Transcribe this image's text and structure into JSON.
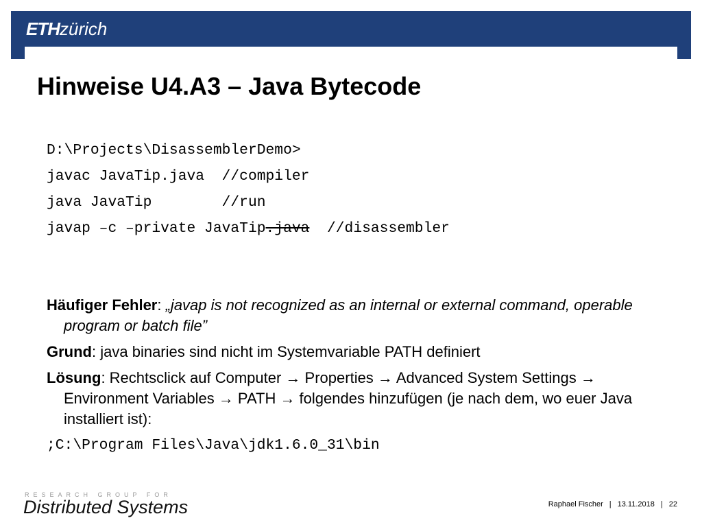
{
  "header": {
    "logo_eth": "ETH",
    "logo_zurich": "zürich",
    "bar_color": "#1f407a"
  },
  "title": "Hinweise U4.A3 – Java Bytecode",
  "code": {
    "line1": "D:\\Projects\\DisassemblerDemo>",
    "line2": "javac JavaTip.java  //compiler",
    "line3": "java JavaTip        //run",
    "line4_before": "javap –c –private JavaTip",
    "line4_struck": ".java",
    "line4_after": "  //disassembler"
  },
  "notes": {
    "error_label": "Häufiger Fehler",
    "error_sep": ": ",
    "error_text": "„javap is not recognized as an internal or external command, operable program or batch file”",
    "reason_label": "Grund",
    "reason_sep": ": ",
    "reason_text": "java binaries sind nicht im Systemvariable PATH definiert",
    "solution_label": "Lösung",
    "solution_sep": ": ",
    "solution_text": "Rechtsclick auf Computer → Properties → Advanced System Settings → Environment Variables → PATH → folgendes hinzufügen (je nach dem, wo euer Java installiert ist):",
    "path": ";C:\\Program Files\\Java\\jdk1.6.0_31\\bin"
  },
  "footer": {
    "research_group": "RESEARCH GROUP FOR",
    "group_name": "Distributed Systems",
    "author": "Raphael Fischer",
    "sep": "|",
    "date": "13.11.2018",
    "page": "22"
  }
}
